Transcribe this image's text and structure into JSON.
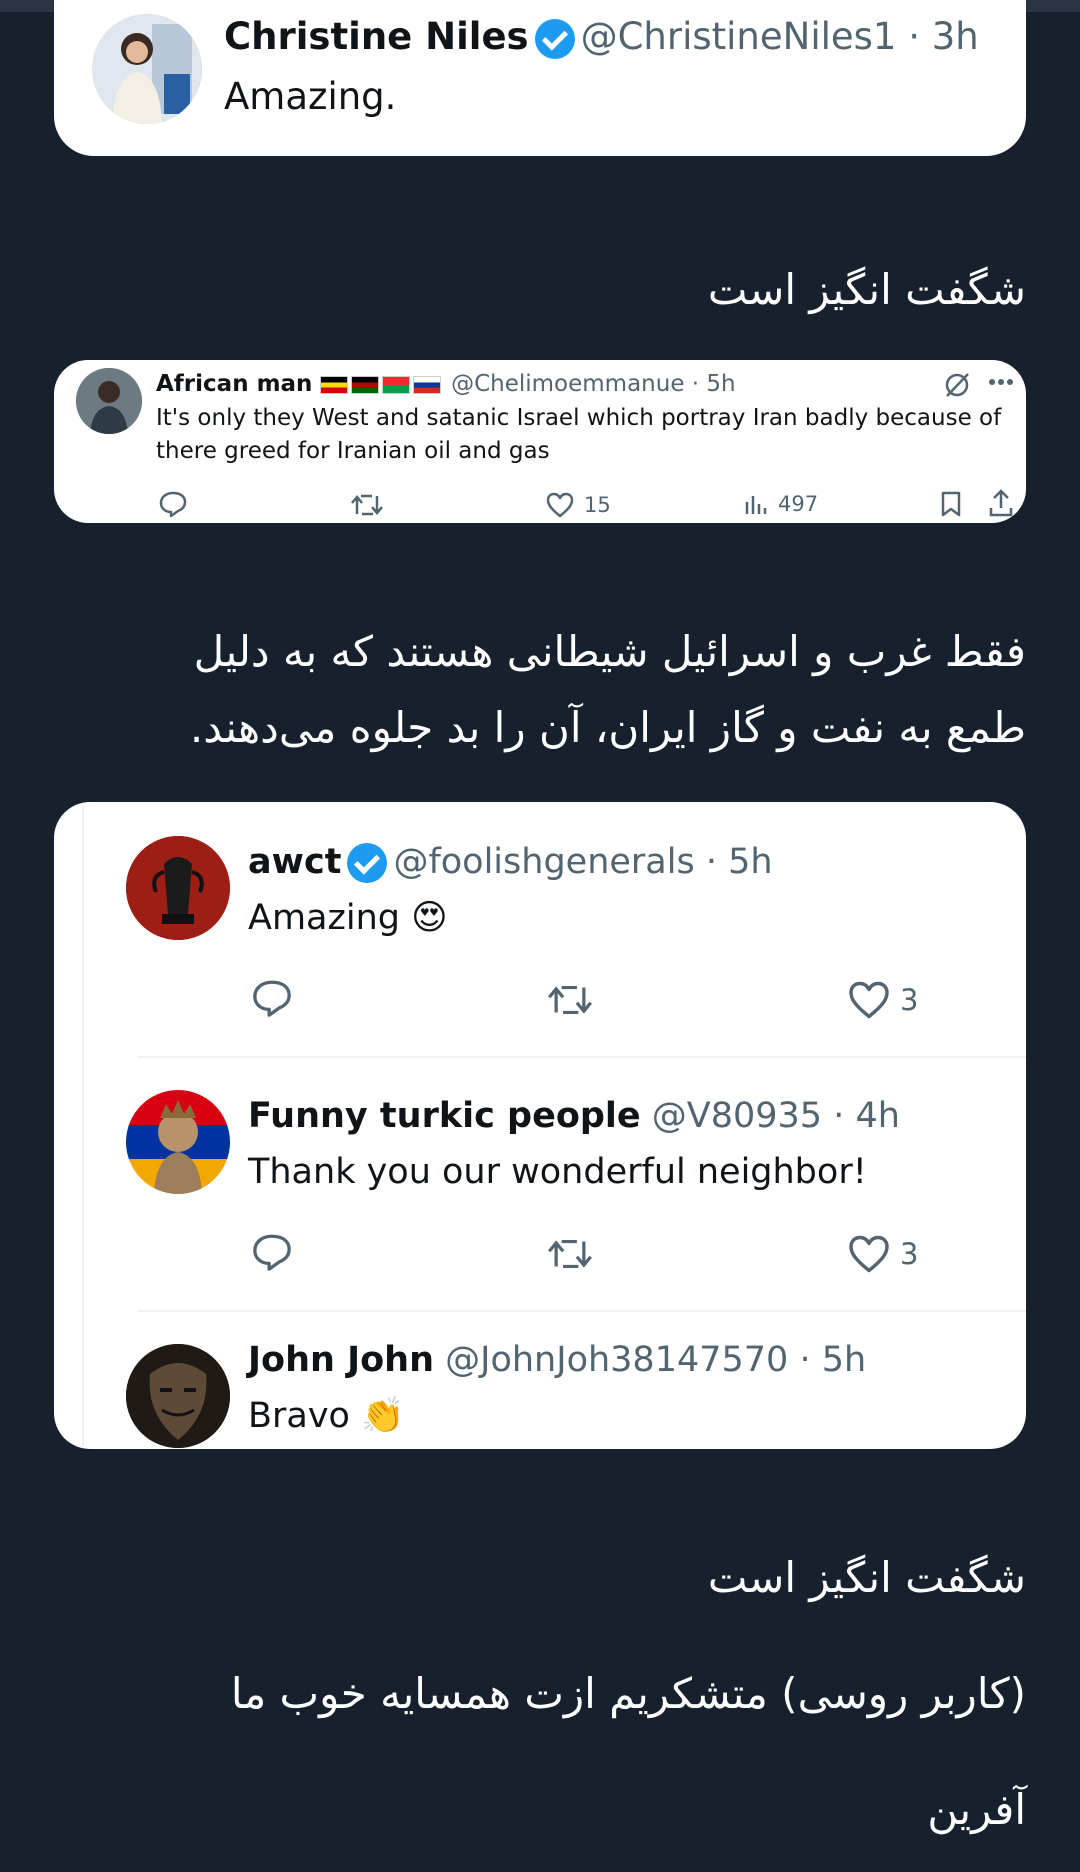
{
  "tweet1": {
    "name": "Christine Niles",
    "handle": "@ChristineNiles1",
    "time": "· 3h",
    "text": "Amazing."
  },
  "caption1": "شگفت انگیز است",
  "tweet2": {
    "name": "African man",
    "flags": [
      "uganda",
      "kenya",
      "burkina-faso",
      "russia"
    ],
    "handle": "@Chelimoemmanue · 5h",
    "text_line1": "It's only they West and satanic Israel which portray Iran badly because of",
    "text_line2": "there greed for Iranian oil and gas",
    "likes": "15",
    "views": "497"
  },
  "caption2_line1": "فقط غرب و اسرائیل شیطانی هستند که به دلیل",
  "caption2_line2": "طمع به نفت و گاز ایران، آن را بد جلوه می‌دهند.",
  "replies": [
    {
      "name": "awct",
      "handle": "@foolishgenerals",
      "time": "· 5h",
      "text": "Amazing",
      "emoji": "😍",
      "likes": "3"
    },
    {
      "name": "Funny turkic people",
      "handle": "@V80935",
      "time": "· 4h",
      "text": "Thank you our wonderful neighbor!",
      "likes": "3"
    },
    {
      "name": "John John",
      "handle": "@JohnJoh38147570",
      "time": "· 5h",
      "text": "Bravo",
      "emoji": "👏"
    }
  ],
  "caption3": "شگفت انگیز است",
  "caption4": "(کاربر روسی) متشکریم ازت همسایه خوب ما",
  "caption5": "آفرین",
  "colors": {
    "background": "#17202d",
    "verified": "#1d9bf0",
    "muted": "#536471"
  }
}
